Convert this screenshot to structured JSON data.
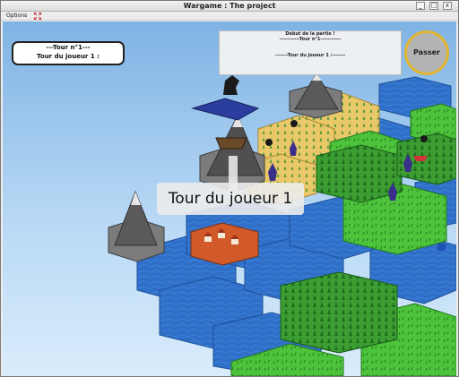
{
  "window": {
    "title": "Wargame : The project",
    "minimize_glyph": "_",
    "maximize_glyph": "□",
    "close_glyph": "x"
  },
  "menu": {
    "options_label": "Options",
    "fullscreen_icon": "fullscreen-arrows-icon"
  },
  "hud": {
    "turn_line": "---Tour n°1---",
    "player_line": "Tour du joueur 1 :",
    "log_lines": [
      "Debut de la partie !",
      "-----------Tour n°1-----------",
      "",
      "-------Tour du joueur 1 :-------"
    ],
    "pass_label": "Passer",
    "banner": "Tour du joueur 1"
  },
  "colors": {
    "water": "#2f6fc8",
    "grass": "#3fae2f",
    "forest": "#2d8a2a",
    "sand": "#e6c46a",
    "mountain": "#5f5f5f",
    "enemy": "#2a2a6e",
    "pass_ring": "#e2b532"
  }
}
